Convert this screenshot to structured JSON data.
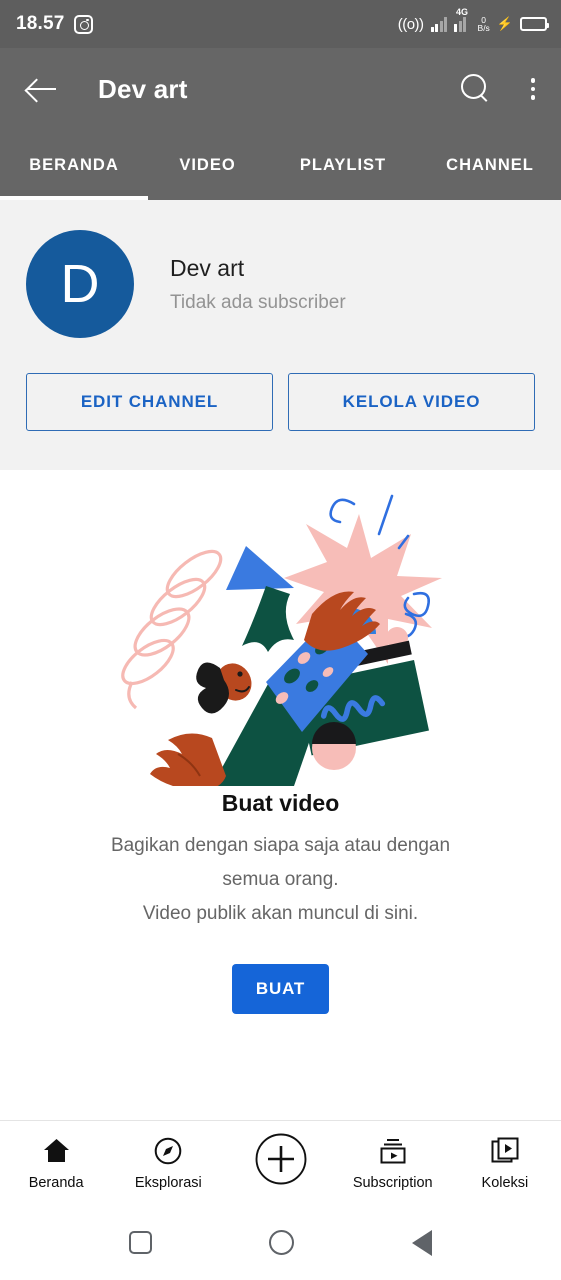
{
  "status_bar": {
    "time": "18.57",
    "app_icon": "instagram-icon",
    "cast_icon": "((o))",
    "network_type": "4G",
    "net_speed_value": "0",
    "net_speed_unit": "B/s",
    "charging_icon": "⚡",
    "battery_icon": "battery-icon"
  },
  "app_bar": {
    "back_icon": "back-arrow-icon",
    "title": "Dev art",
    "search_icon": "search-icon",
    "overflow_icon": "more-vertical-icon"
  },
  "tabs": {
    "items": [
      {
        "label": "BERANDA",
        "active": true
      },
      {
        "label": "VIDEO",
        "active": false
      },
      {
        "label": "PLAYLIST",
        "active": false
      },
      {
        "label": "CHANNEL",
        "active": false
      }
    ]
  },
  "channel": {
    "avatar_letter": "D",
    "avatar_color": "#155a9c",
    "name": "Dev art",
    "subscribers": "Tidak ada subscriber",
    "buttons": [
      {
        "label": "EDIT CHANNEL"
      },
      {
        "label": "KELOLA VIDEO"
      }
    ],
    "button_color": "#1b63c4"
  },
  "empty_state": {
    "illustration": "create-video-illustration",
    "title": "Buat video",
    "line1": "Bagikan dengan siapa saja atau dengan",
    "line2": "semua orang.",
    "line3": "Video publik akan muncul di sini.",
    "cta_label": "BUAT",
    "cta_color": "#1565d8"
  },
  "bottom_nav": {
    "items": [
      {
        "label": "Beranda",
        "icon": "home-icon"
      },
      {
        "label": "Eksplorasi",
        "icon": "compass-icon"
      },
      {
        "label": "",
        "icon": "plus-circle-icon"
      },
      {
        "label": "Subscription",
        "icon": "subscriptions-icon"
      },
      {
        "label": "Koleksi",
        "icon": "library-icon"
      }
    ]
  },
  "android_nav": {
    "recents_icon": "square-recents-icon",
    "home_icon": "circle-home-icon",
    "back_icon": "triangle-back-icon"
  }
}
